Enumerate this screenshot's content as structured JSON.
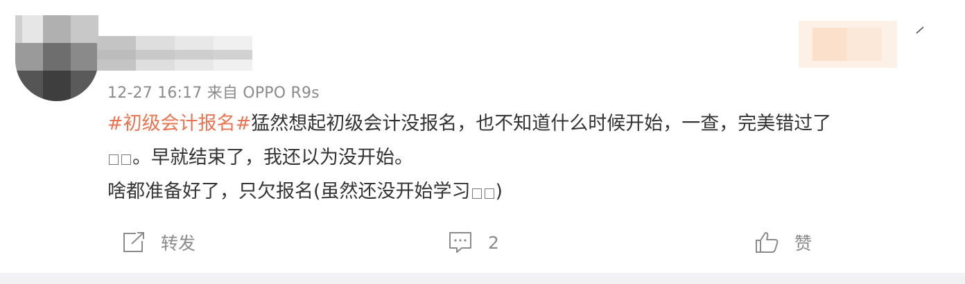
{
  "post": {
    "meta": "12-27 16:17 来自 OPPO R9s",
    "hashtag": "#初级会计报名#",
    "line1_rest": "猛然想起初级会计没报名，也不知道什么时候开始，一查，完美错过了",
    "line2_text": "。早就结束了，我还以为没开始。",
    "line3_text": "啥都准备好了，只欠报名(虽然还没开始学习",
    "line3_end": ")"
  },
  "actions": {
    "repost_label": "转发",
    "comment_count": "2",
    "like_label": "赞"
  },
  "colors": {
    "hashtag": "#eb7350",
    "text": "#333333",
    "meta": "#8a8a8a"
  },
  "icons": [
    "share-icon",
    "comment-icon",
    "like-icon",
    "chevron-down-icon"
  ]
}
